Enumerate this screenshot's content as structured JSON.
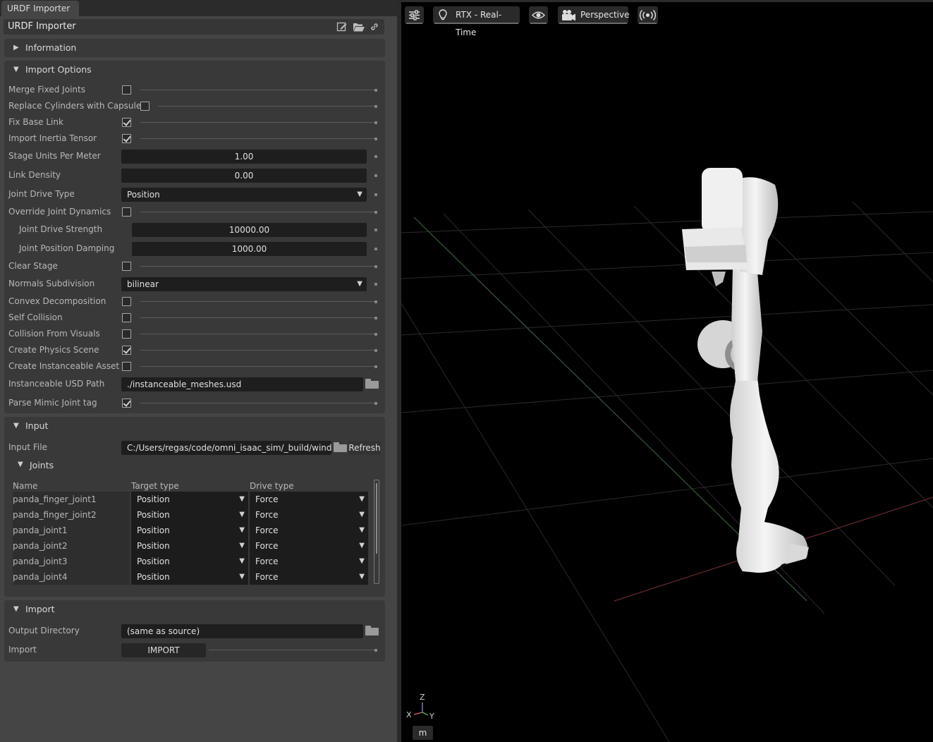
{
  "window": {
    "tab_label": "URDF Importer",
    "title": "URDF Importer",
    "title_icons": [
      "edit-icon",
      "folder-open-icon",
      "link-icon"
    ]
  },
  "sections": {
    "information": {
      "label": "Information",
      "expanded": false
    },
    "import_options": {
      "label": "Import Options",
      "expanded": true
    },
    "input": {
      "label": "Input",
      "expanded": true
    },
    "joints": {
      "label": "Joints",
      "expanded": true
    },
    "import": {
      "label": "Import",
      "expanded": true
    }
  },
  "options": {
    "merge_fixed_joints": {
      "label": "Merge Fixed Joints",
      "checked": false
    },
    "replace_cylinders": {
      "label": "Replace Cylinders with Capsules",
      "checked": false
    },
    "fix_base_link": {
      "label": "Fix Base Link",
      "checked": true
    },
    "import_inertia": {
      "label": "Import Inertia Tensor",
      "checked": true
    },
    "stage_units": {
      "label": "Stage Units Per Meter",
      "value": "1.00"
    },
    "link_density": {
      "label": "Link Density",
      "value": "0.00"
    },
    "joint_drive_type": {
      "label": "Joint Drive Type",
      "value": "Position"
    },
    "override_dynamics": {
      "label": "Override Joint Dynamics",
      "checked": false
    },
    "drive_strength": {
      "label": "Joint Drive Strength",
      "value": "10000.00"
    },
    "position_damping": {
      "label": "Joint Position Damping",
      "value": "1000.00"
    },
    "clear_stage": {
      "label": "Clear Stage",
      "checked": false
    },
    "normals_subdivision": {
      "label": "Normals Subdivision",
      "value": "bilinear"
    },
    "convex_decomposition": {
      "label": "Convex Decomposition",
      "checked": false
    },
    "self_collision": {
      "label": "Self Collision",
      "checked": false
    },
    "collision_from_visuals": {
      "label": "Collision From Visuals",
      "checked": false
    },
    "create_physics_scene": {
      "label": "Create Physics Scene",
      "checked": true
    },
    "create_instanceable": {
      "label": "Create Instanceable Asset",
      "checked": false
    },
    "instanceable_path": {
      "label": "Instanceable USD Path",
      "value": "./instanceable_meshes.usd"
    },
    "parse_mimic": {
      "label": "Parse Mimic Joint tag",
      "checked": true
    }
  },
  "input": {
    "file_label": "Input File",
    "file_value": "C:/Users/regas/code/omni_isaac_sim/_build/windows",
    "refresh_label": "Refresh"
  },
  "joints": {
    "headers": [
      "Name",
      "Target type",
      "Drive type"
    ],
    "rows": [
      {
        "name": "panda_finger_joint1",
        "target": "Position",
        "drive": "Force"
      },
      {
        "name": "panda_finger_joint2",
        "target": "Position",
        "drive": "Force"
      },
      {
        "name": "panda_joint1",
        "target": "Position",
        "drive": "Force"
      },
      {
        "name": "panda_joint2",
        "target": "Position",
        "drive": "Force"
      },
      {
        "name": "panda_joint3",
        "target": "Position",
        "drive": "Force"
      },
      {
        "name": "panda_joint4",
        "target": "Position",
        "drive": "Force"
      }
    ]
  },
  "import": {
    "output_label": "Output Directory",
    "output_value": "(same as source)",
    "import_label": "Import",
    "import_button": "IMPORT"
  },
  "viewport": {
    "renderer": "RTX - Real-Time",
    "camera": "Perspective",
    "unit": "m",
    "axis_labels": {
      "z": "Z",
      "x": "X",
      "y": "Y"
    }
  }
}
